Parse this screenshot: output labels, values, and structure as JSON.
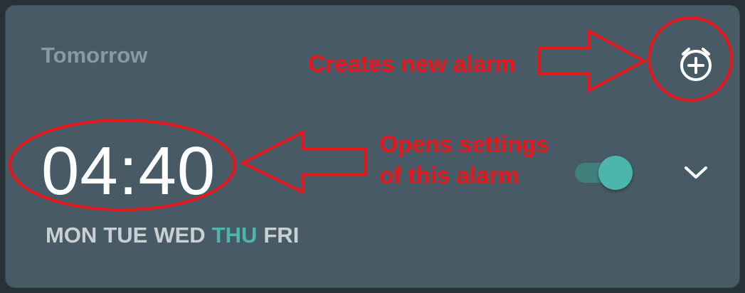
{
  "alarm": {
    "day_label": "Tomorrow",
    "time": "04:40",
    "days": [
      {
        "label": "MON",
        "active": false
      },
      {
        "label": "TUE",
        "active": false
      },
      {
        "label": "WED",
        "active": false
      },
      {
        "label": "THU",
        "active": true
      },
      {
        "label": "FRI",
        "active": false
      }
    ],
    "enabled": true
  },
  "icons": {
    "add_alarm": "add-alarm-icon",
    "expand": "chevron-down-icon"
  },
  "annotations": {
    "new_alarm": "Creates new alarm",
    "open_settings_line1": "Opens settings",
    "open_settings_line2": "of this alarm"
  },
  "colors": {
    "card_background": "#475a65",
    "accent": "#4db6ac",
    "annotation": "#e8151b"
  }
}
